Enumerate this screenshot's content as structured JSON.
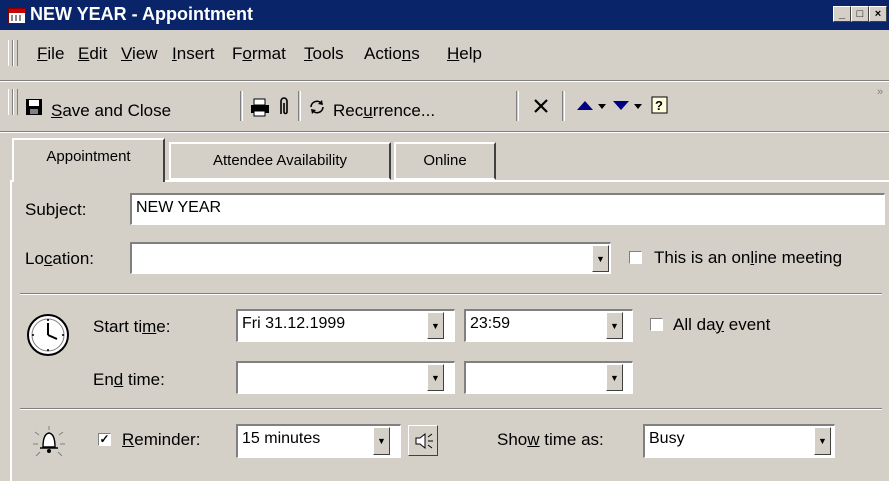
{
  "window": {
    "title": "NEW YEAR - Appointment",
    "controls": {
      "minimize": "_",
      "maximize": "□",
      "close": "×"
    }
  },
  "menu": {
    "items": [
      {
        "label": "File",
        "accel": "F"
      },
      {
        "label": "Edit",
        "accel": "E"
      },
      {
        "label": "View",
        "accel": "V"
      },
      {
        "label": "Insert",
        "accel": "I"
      },
      {
        "label": "Format",
        "accel": "o"
      },
      {
        "label": "Tools",
        "accel": "T"
      },
      {
        "label": "Actions",
        "accel": "n"
      },
      {
        "label": "Help",
        "accel": "H"
      }
    ]
  },
  "toolbar": {
    "save_label": "Save and Close",
    "recurrence_label": "Recurrence...",
    "print_icon": "print-icon",
    "attach_icon": "paperclip-icon",
    "delete_icon": "delete-x-icon",
    "prev_icon": "previous-item-icon",
    "next_icon": "next-item-icon",
    "help_icon": "help-icon",
    "overflow": "»"
  },
  "tabs": [
    {
      "label": "Appointment",
      "active": true
    },
    {
      "label": "Attendee Availability",
      "active": false
    },
    {
      "label": "Online",
      "active": false
    }
  ],
  "form": {
    "subject_label": "Subject:",
    "subject_value": "NEW YEAR",
    "location_label": "Location:",
    "location_value": "",
    "online_meeting_label": "This is an online meeting",
    "online_meeting_checked": false,
    "start_label": "Start time:",
    "start_date": "Fri 31.12.1999",
    "start_time": "23:59",
    "all_day_label": "All day event",
    "all_day_checked": false,
    "end_label": "End time:",
    "end_date": "",
    "end_time": "",
    "reminder_label": "Reminder:",
    "reminder_checked": true,
    "reminder_value": "15 minutes",
    "show_time_as_label": "Show time as:",
    "show_time_as_value": "Busy"
  },
  "icons": {
    "clock": "clock-icon",
    "bell": "reminder-bell-icon",
    "sound": "reminder-sound-icon"
  }
}
